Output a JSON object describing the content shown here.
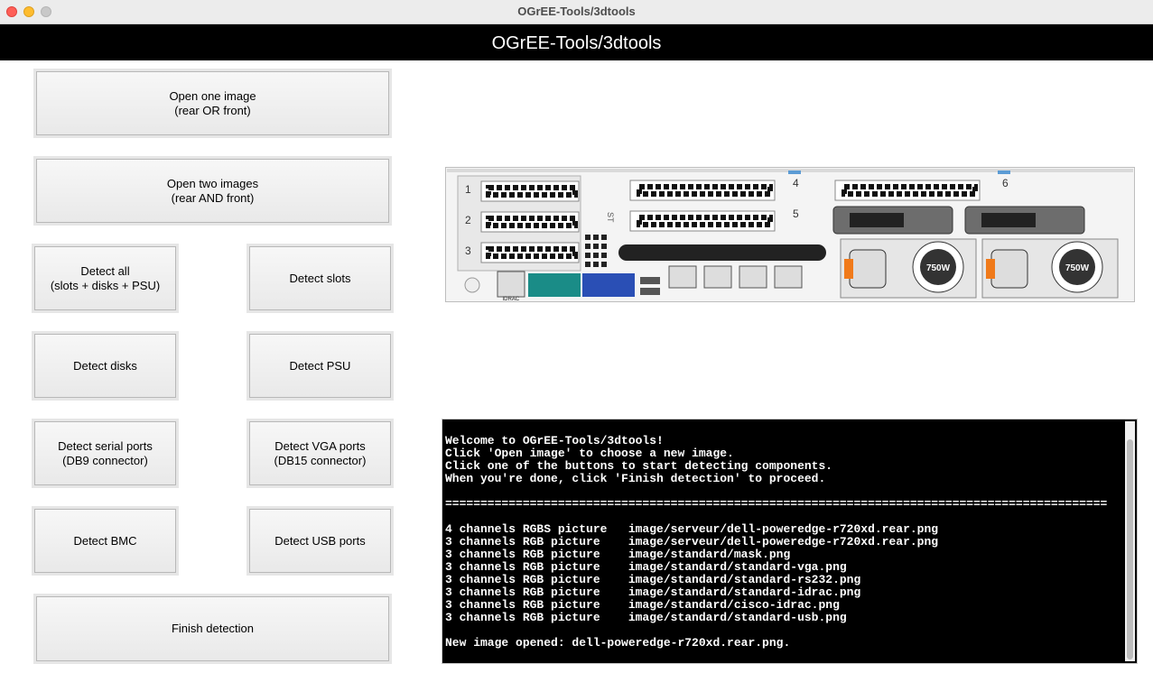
{
  "window": {
    "title": "OGrEE-Tools/3dtools"
  },
  "header": {
    "title": "OGrEE-Tools/3dtools"
  },
  "buttons": {
    "open_one": "Open one image\n(rear OR front)",
    "open_two": "Open two images\n(rear AND front)",
    "detect_all": "Detect all\n(slots + disks + PSU)",
    "detect_slots": "Detect slots",
    "detect_disks": "Detect disks",
    "detect_psu": "Detect PSU",
    "detect_serial": "Detect serial ports\n(DB9 connector)",
    "detect_vga": "Detect VGA ports\n(DB15 connector)",
    "detect_bmc": "Detect BMC",
    "detect_usb": "Detect USB ports",
    "finish": "Finish detection"
  },
  "server_image": {
    "slot_numbers": [
      "1",
      "2",
      "3",
      "4",
      "5",
      "6"
    ],
    "psu_labels": [
      "750W",
      "750W"
    ],
    "idrac_label": "iDRAC",
    "riser_label": "ST"
  },
  "console": {
    "lines": [
      "Welcome to OGrEE-Tools/3dtools!",
      "Click 'Open image' to choose a new image.",
      "Click one of the buttons to start detecting components.",
      "When you're done, click 'Finish detection' to proceed.",
      "",
      "==============================================================================================",
      "",
      "4 channels RGBS picture   image/serveur/dell-poweredge-r720xd.rear.png",
      "3 channels RGB picture    image/serveur/dell-poweredge-r720xd.rear.png",
      "3 channels RGB picture    image/standard/mask.png",
      "3 channels RGB picture    image/standard/standard-vga.png",
      "3 channels RGB picture    image/standard/standard-rs232.png",
      "3 channels RGB picture    image/standard/standard-idrac.png",
      "3 channels RGB picture    image/standard/cisco-idrac.png",
      "3 channels RGB picture    image/standard/standard-usb.png",
      "",
      "New image opened: dell-poweredge-r720xd.rear.png."
    ]
  }
}
